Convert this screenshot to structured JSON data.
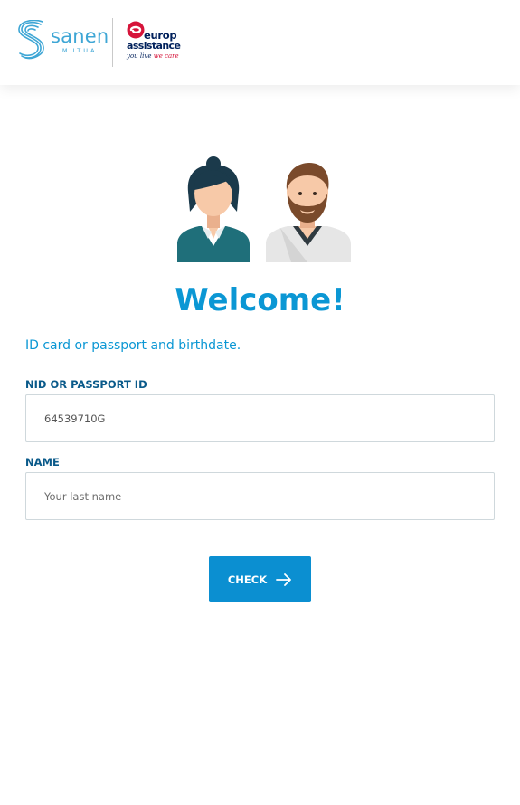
{
  "brand": {
    "sanen_name": "sanen",
    "sanen_sub": "MUTUA",
    "europ_line1": "europ",
    "europ_line2": "assistance",
    "tagline_part1": "you live ",
    "tagline_part2": "we care"
  },
  "main": {
    "welcome": "Welcome!",
    "subtitle": "ID card or passport and birthdate."
  },
  "form": {
    "nid": {
      "label": "NID OR PASSPORT ID",
      "value": "64539710G"
    },
    "name": {
      "label": "NAME",
      "placeholder": "Your last name",
      "value": ""
    },
    "submit_label": "CHECK"
  },
  "colors": {
    "primary": "#0b8fd1",
    "heading": "#0b97d4",
    "label": "#0a5a8a",
    "teal_uniform": "#1f6f7a",
    "skin": "#f7c9a8",
    "beard": "#7a4a2b"
  },
  "icons": {
    "submit": "arrow-right-icon",
    "sanen_logo": "sanen-s-logo-icon",
    "europ_logo": "europ-assistance-logo-icon",
    "avatars": "customer-service-avatars-icon"
  }
}
